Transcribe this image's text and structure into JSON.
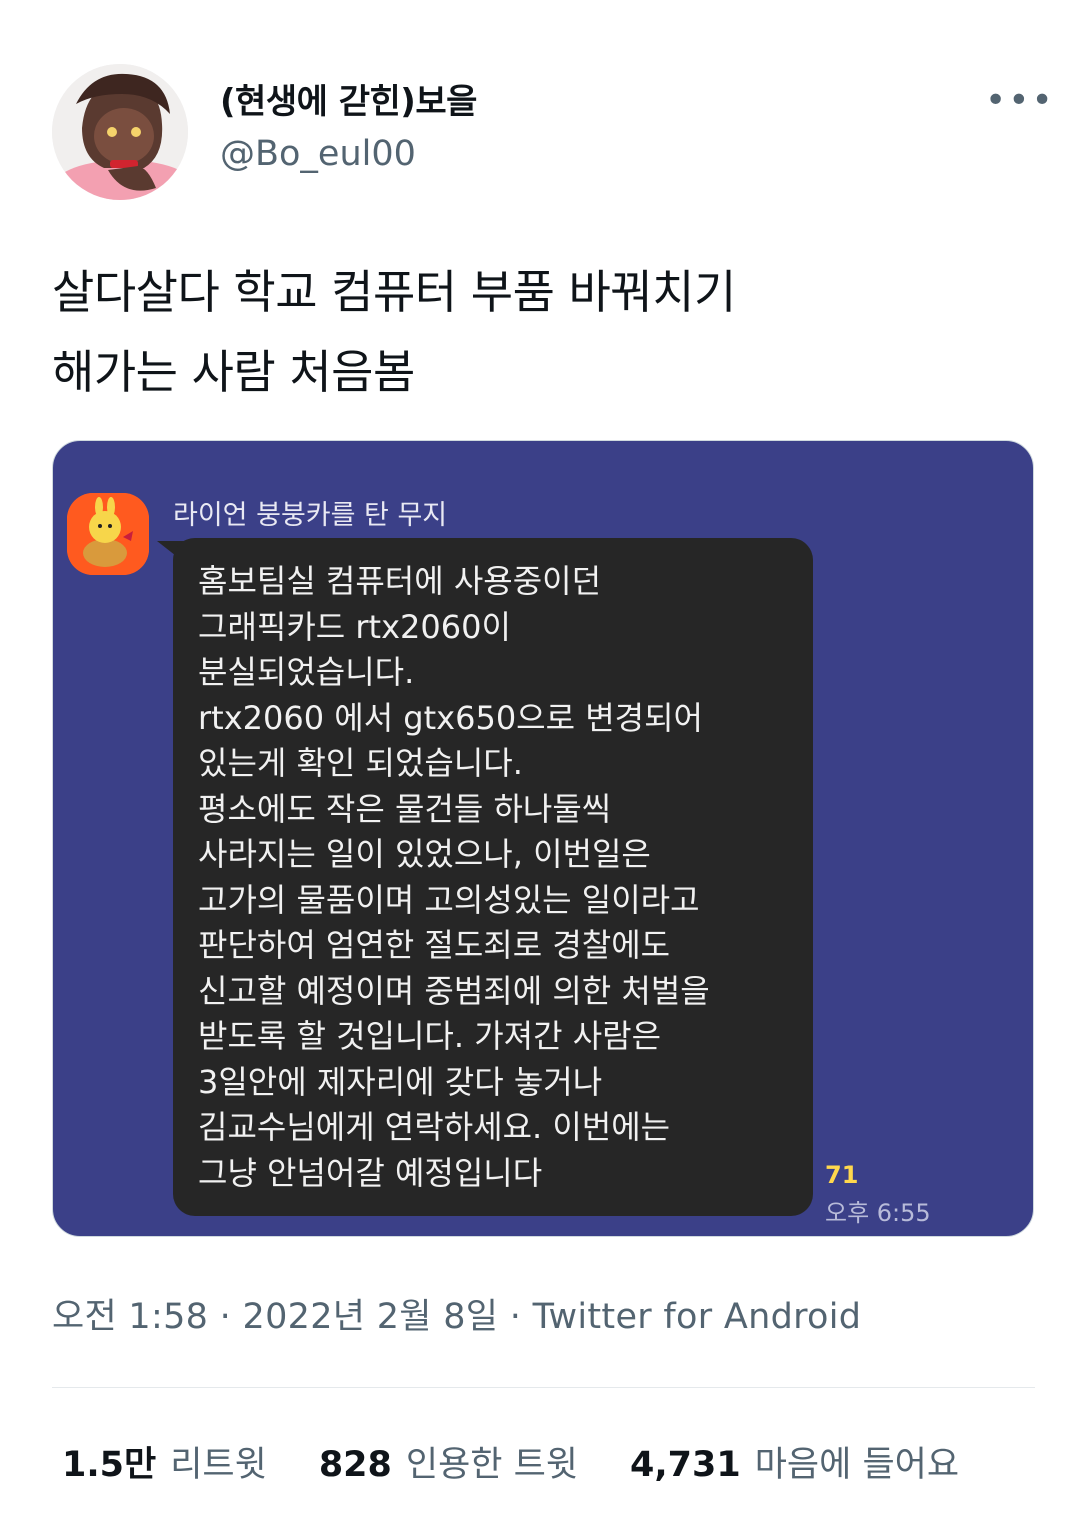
{
  "author": {
    "display_name": "(현생에 갇힌)보을",
    "handle": "@Bo_eul00",
    "avatar_icon": "profile-avatar"
  },
  "more_icon": "more-horizontal-icon",
  "tweet": {
    "text": "살다살다 학교 컴퓨터 부품 바꿔치기\n해가는 사람 처음봄"
  },
  "chat_image": {
    "sender": "라이언 붕붕카를 탄 무지",
    "message_lines": [
      "홈보팀실 컴퓨터에 사용중이던",
      "그래픽카드 rtx2060이",
      "분실되었습니다.",
      "rtx2060 에서 gtx650으로 변경되어",
      "있는게 확인 되었습니다.",
      "평소에도 작은 물건들 하나둘씩",
      "사라지는 일이 있었으나, 이번일은",
      "고가의 물품이며 고의성있는 일이라고",
      "판단하여 엄연한 절도죄로 경찰에도",
      "신고할 예정이며 중범죄에 의한 처벌을",
      "받도록 할 것입니다. 가져간 사람은",
      "3일안에 제자리에 갖다 놓거나",
      "김교수님에게 연락하세요. 이번에는",
      "그냥 안넘어갈 예정입니다"
    ],
    "unread_count": "71",
    "time": "오후 6:55",
    "colors": {
      "background": "#3b4088",
      "bubble": "#262626",
      "unread": "#ffd84d"
    }
  },
  "meta": {
    "time": "오전 1:58",
    "sep1": " · ",
    "date": "2022년 2월 8일",
    "sep2": " · ",
    "source": "Twitter for Android"
  },
  "stats": [
    {
      "count": "1.5만",
      "label": "리트윗"
    },
    {
      "count": "828",
      "label": "인용한 트윗"
    },
    {
      "count": "4,731",
      "label": "마음에 들어요"
    }
  ]
}
